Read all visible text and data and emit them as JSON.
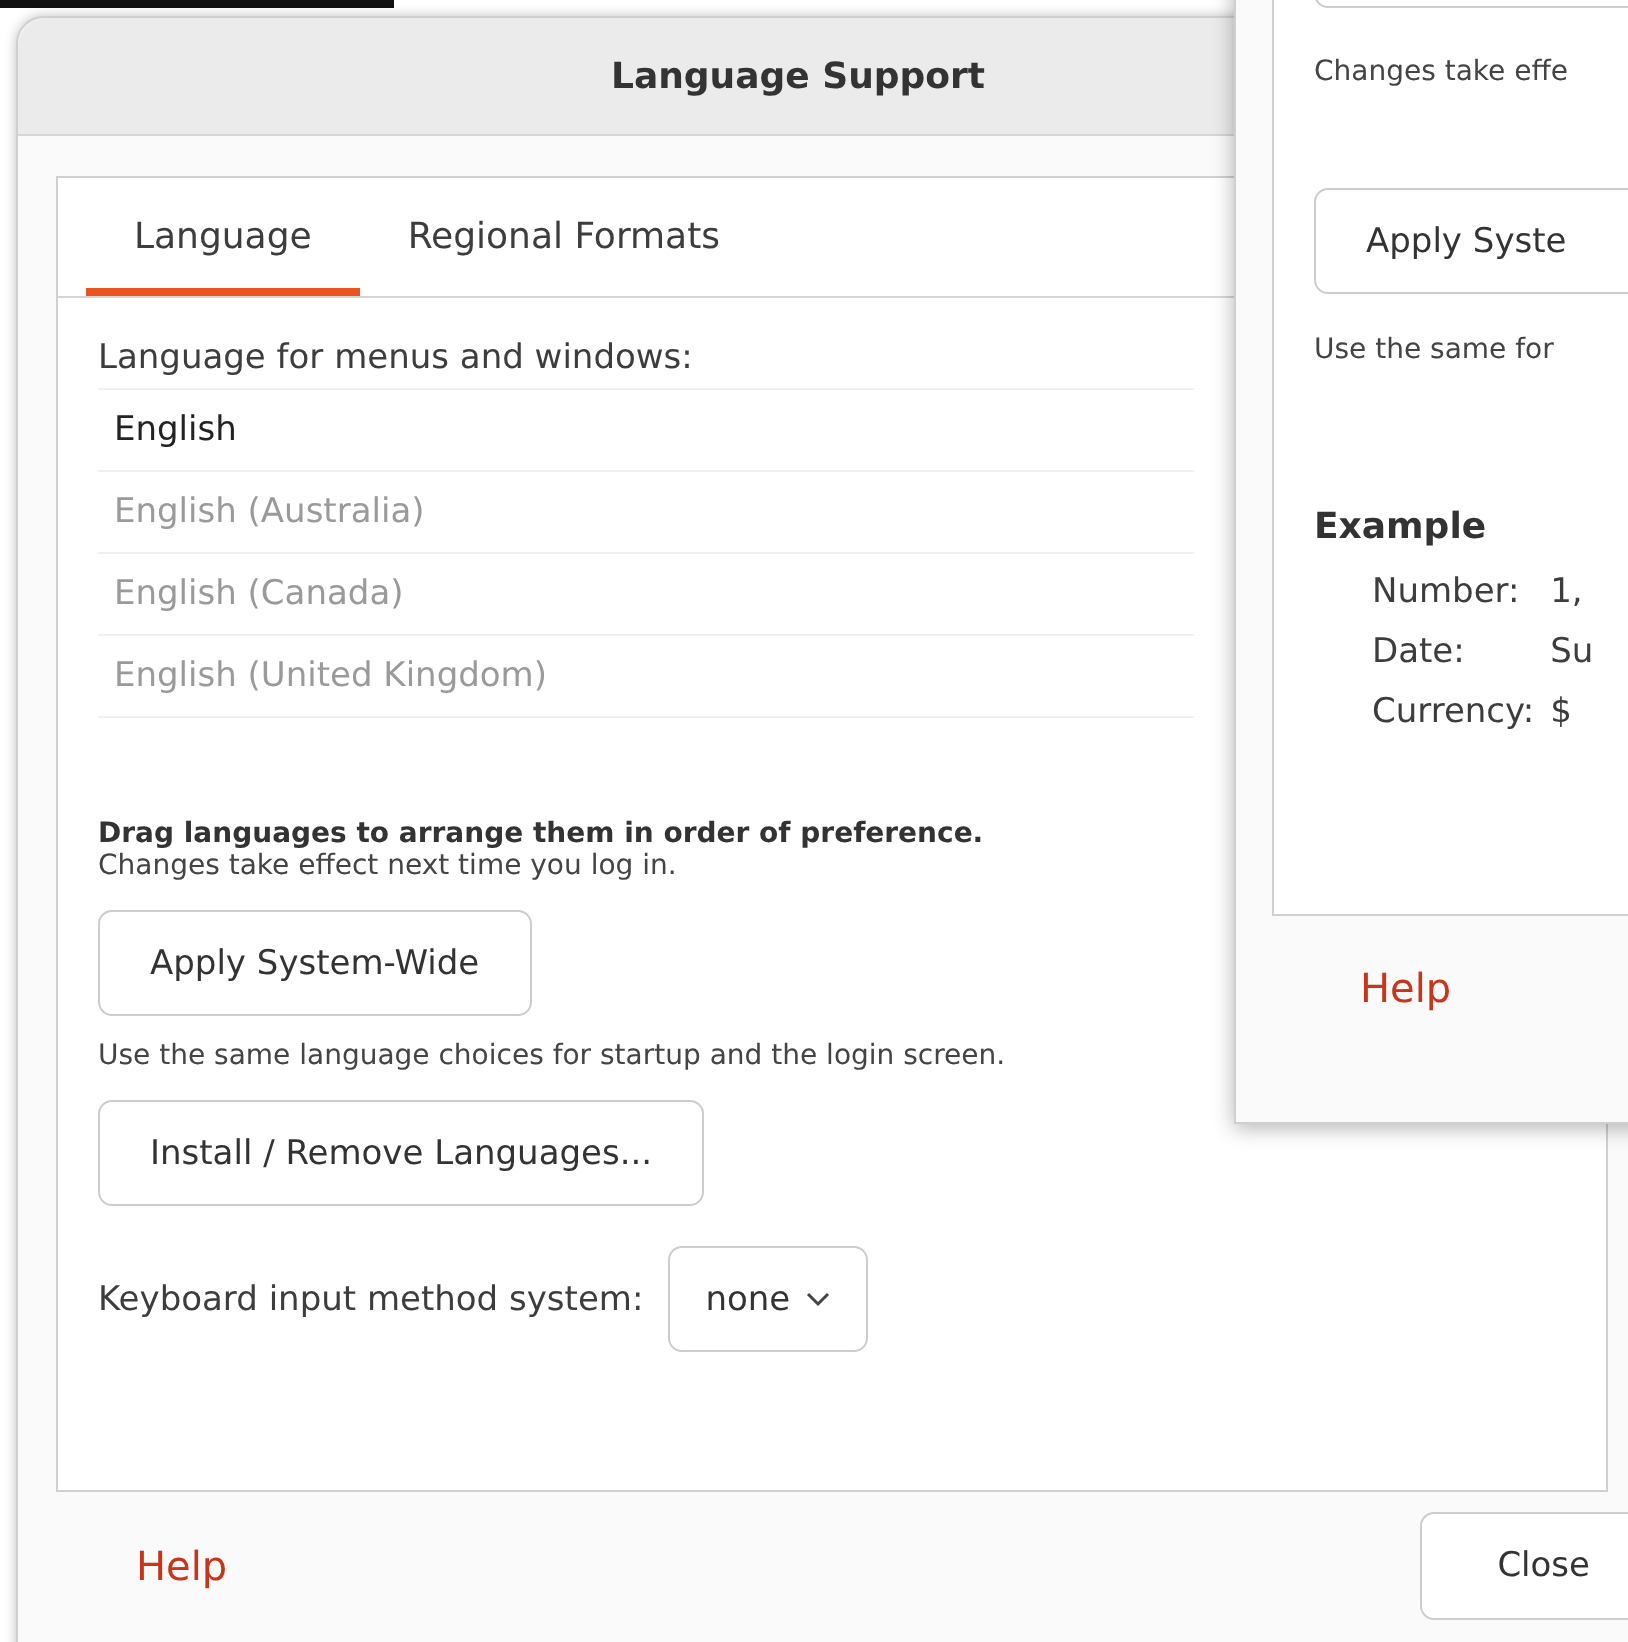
{
  "window": {
    "title": "Language Support"
  },
  "tabs": [
    {
      "label": "Language",
      "selected": true
    },
    {
      "label": "Regional Formats",
      "selected": false
    }
  ],
  "language_list": {
    "heading": "Language for menus and windows:",
    "items": [
      {
        "label": "English",
        "disabled": false
      },
      {
        "label": "English (Australia)",
        "disabled": true
      },
      {
        "label": "English (Canada)",
        "disabled": true
      },
      {
        "label": "English (United Kingdom)",
        "disabled": true
      }
    ]
  },
  "hint": {
    "title": "Drag languages to arrange them in order of preference.",
    "text": "Changes take effect next time you log in."
  },
  "apply_button": "Apply System-Wide",
  "apply_note": "Use the same language choices for startup and the login screen.",
  "install_button": "Install / Remove Languages...",
  "input_method": {
    "label": "Keyboard input method system:",
    "value": "none"
  },
  "footer": {
    "help": "Help",
    "close": "Close"
  },
  "second_window": {
    "changes_note": "Changes take effe",
    "apply_button": "Apply Syste",
    "apply_note": "Use the same for",
    "example_title": "Example",
    "example_rows": [
      {
        "label": "Number:",
        "value": "1,"
      },
      {
        "label": "Date:",
        "value": "Su"
      },
      {
        "label": "Currency:",
        "value": "$"
      }
    ],
    "help": "Help"
  }
}
